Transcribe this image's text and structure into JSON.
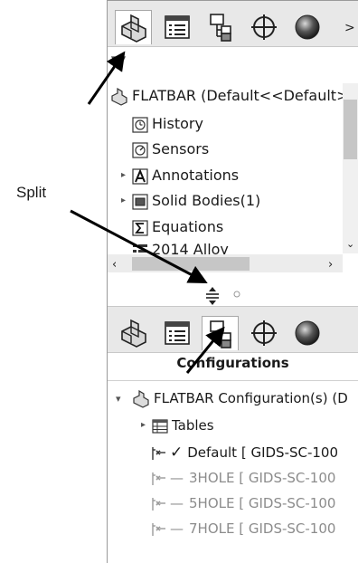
{
  "callout": {
    "label": "Split"
  },
  "top_tabs": {
    "tabs": [
      {
        "icon": "feature-manager-icon",
        "active": true
      },
      {
        "icon": "property-manager-icon",
        "active": false
      },
      {
        "icon": "configuration-manager-icon",
        "active": false
      },
      {
        "icon": "dimxpert-manager-icon",
        "active": false
      },
      {
        "icon": "display-manager-icon",
        "active": false
      }
    ],
    "more": ">"
  },
  "tree": {
    "root": "FLATBAR  (Default<<Default>",
    "items": [
      {
        "label": "History",
        "icon": "history-icon",
        "expandable": false
      },
      {
        "label": "Sensors",
        "icon": "sensors-icon",
        "expandable": false
      },
      {
        "label": "Annotations",
        "icon": "annotations-icon",
        "expandable": true
      },
      {
        "label": "Solid Bodies(1)",
        "icon": "solid-bodies-icon",
        "expandable": true
      },
      {
        "label": "Equations",
        "icon": "equations-icon",
        "expandable": false
      },
      {
        "label": "2014 Alloy",
        "icon": "material-icon",
        "expandable": false
      }
    ]
  },
  "bottom_tabs": {
    "tabs": [
      {
        "icon": "feature-manager-icon",
        "active": false
      },
      {
        "icon": "property-manager-icon",
        "active": false
      },
      {
        "icon": "configuration-manager-icon",
        "active": true
      },
      {
        "icon": "dimxpert-manager-icon",
        "active": false
      },
      {
        "icon": "display-manager-icon",
        "active": false
      }
    ]
  },
  "configurations": {
    "title": "Configurations",
    "root": "FLATBAR Configuration(s)  (D",
    "tables": "Tables",
    "items": [
      {
        "label": "Default [ GIDS-SC-100",
        "active": true
      },
      {
        "label": "3HOLE [ GIDS-SC-100",
        "active": false
      },
      {
        "label": "5HOLE [ GIDS-SC-100",
        "active": false
      },
      {
        "label": "7HOLE [ GIDS-SC-100",
        "active": false
      }
    ]
  },
  "colors": {
    "panel_bg": "#ffffff",
    "tab_bar_bg": "#e8e8e8",
    "inactive_text": "#8c8c8c",
    "scroll_thumb": "#c6c6c6"
  }
}
